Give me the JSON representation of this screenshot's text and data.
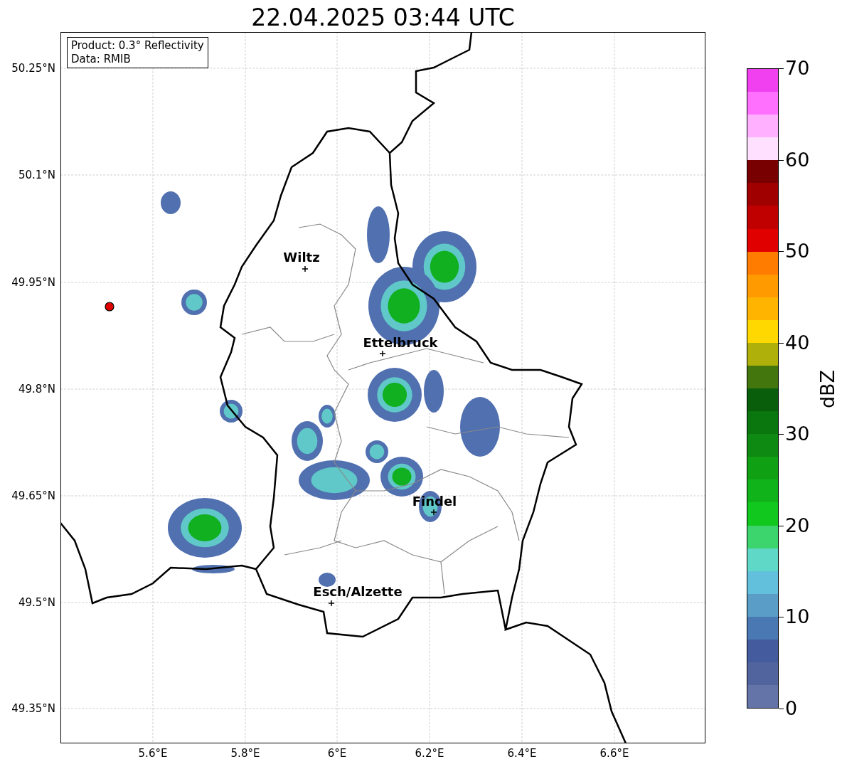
{
  "title": "22.04.2025 03:44 UTC",
  "info_box": {
    "lines": [
      "Product: 0.3° Reflectivity",
      "Data: RMIB"
    ]
  },
  "map": {
    "cities": [
      {
        "name": "Wiltz"
      },
      {
        "name": "Ettelbruck"
      },
      {
        "name": "Findel"
      },
      {
        "name": "Esch/Alzette"
      }
    ],
    "y_ticks": [
      "50.25°N",
      "50.1°N",
      "49.95°N",
      "49.8°N",
      "49.65°N",
      "49.5°N",
      "49.35°N"
    ],
    "x_ticks": [
      "5.6°E",
      "5.8°E",
      "6°E",
      "6.2°E",
      "6.4°E",
      "6.6°E"
    ]
  },
  "colorbar": {
    "label": "dBZ",
    "ticks": [
      "70",
      "60",
      "50",
      "40",
      "30",
      "20",
      "10",
      "0"
    ],
    "bands": [
      {
        "color": "#f040f0"
      },
      {
        "color": "#ff70ff"
      },
      {
        "color": "#ffb0ff"
      },
      {
        "color": "#ffe0ff"
      },
      {
        "color": "#780000"
      },
      {
        "color": "#a00000"
      },
      {
        "color": "#c00000"
      },
      {
        "color": "#e00000"
      },
      {
        "color": "#ff7c00"
      },
      {
        "color": "#ff9a00"
      },
      {
        "color": "#ffb400"
      },
      {
        "color": "#ffd800"
      },
      {
        "color": "#b0b00a"
      },
      {
        "color": "#44760e"
      },
      {
        "color": "#085e0a"
      },
      {
        "color": "#0a760e"
      },
      {
        "color": "#0e8a12"
      },
      {
        "color": "#10a014"
      },
      {
        "color": "#10b41a"
      },
      {
        "color": "#10c81e"
      },
      {
        "color": "#3cd46c"
      },
      {
        "color": "#60d8c8"
      },
      {
        "color": "#62c0dc"
      },
      {
        "color": "#5a9ec8"
      },
      {
        "color": "#4a78b2"
      },
      {
        "color": "#445c9e"
      },
      {
        "color": "#52649e"
      },
      {
        "color": "#6474a8"
      }
    ]
  }
}
